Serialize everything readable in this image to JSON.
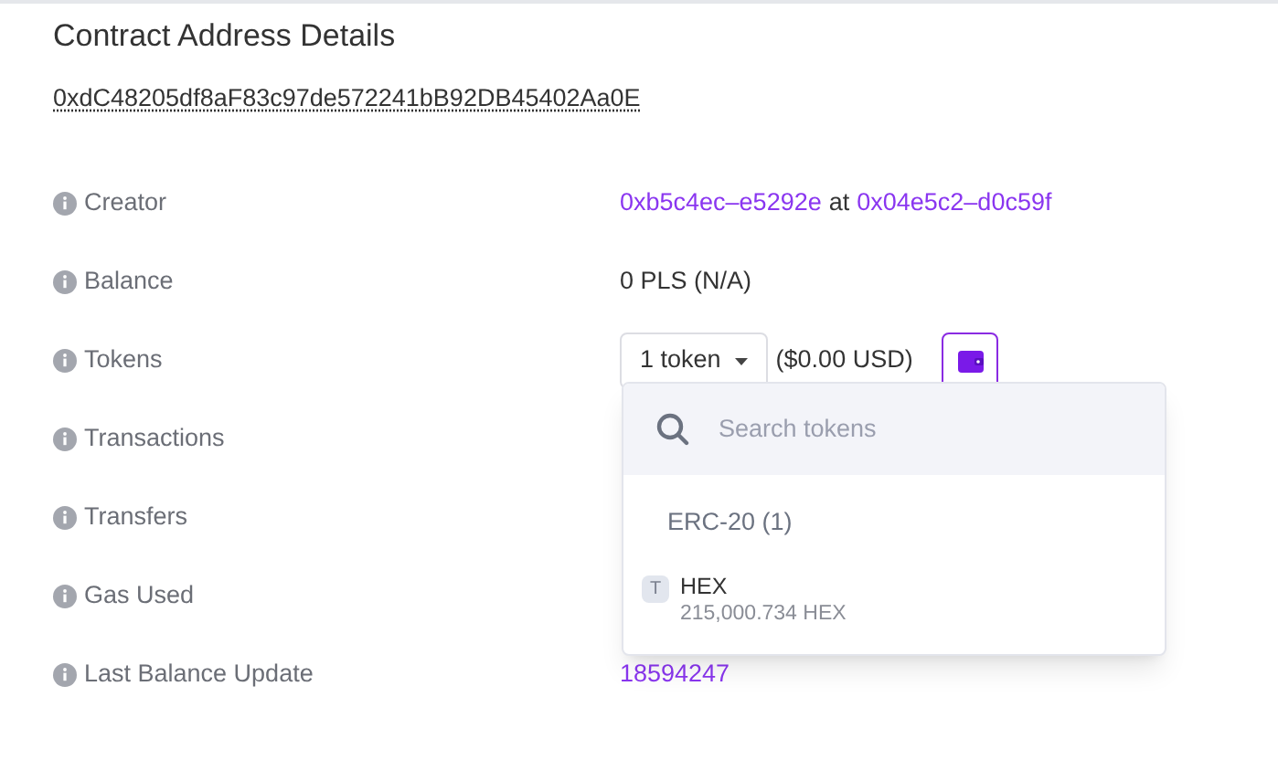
{
  "title": "Contract Address Details",
  "address": "0xdC48205df8aF83c97de572241bB92DB45402Aa0E",
  "rows": [
    {
      "label": "Creator",
      "kind": "creator",
      "creator": "0xb5c4ec–e5292e",
      "joiner": "at",
      "tx": "0x04e5c2–d0c59f"
    },
    {
      "label": "Balance",
      "kind": "text",
      "value": "0 PLS (N/A)"
    },
    {
      "label": "Tokens",
      "kind": "tokens",
      "button": "1 token",
      "usd": "($0.00 USD)"
    },
    {
      "label": "Transactions",
      "kind": "hidden"
    },
    {
      "label": "Transfers",
      "kind": "hidden"
    },
    {
      "label": "Gas Used",
      "kind": "hidden"
    },
    {
      "label": "Last Balance Update",
      "kind": "link",
      "value": "18594247"
    }
  ],
  "dropdown": {
    "search": {
      "placeholder": "Search tokens"
    },
    "group": "ERC-20 (1)",
    "tokens": [
      {
        "badge": "T",
        "name": "HEX",
        "amount": "215,000.734 HEX"
      }
    ]
  }
}
